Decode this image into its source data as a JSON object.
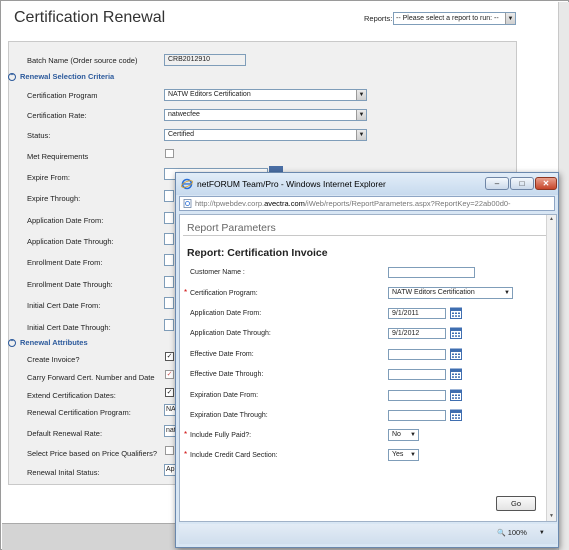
{
  "background": {
    "page_title": "Certification Renewal",
    "reports_label": "Reports:",
    "reports_select": "-- Please select a report to run: --",
    "batch_label": "Batch Name (Order source code)",
    "batch_value": "CRB2012910",
    "sections": {
      "selection": "Renewal Selection Criteria",
      "attributes": "Renewal Attributes"
    },
    "selection_fields": {
      "certification_program": {
        "label": "Certification Program",
        "value": "NATW Editors Certification"
      },
      "certification_rate": {
        "label": "Certification Rate:",
        "value": "natwecfee"
      },
      "status": {
        "label": "Status:",
        "value": "Certified"
      },
      "met_requirements": {
        "label": "Met Requirements"
      },
      "expire_from": {
        "label": "Expire From:"
      },
      "expire_through": {
        "label": "Expire Through:"
      },
      "application_date_from": {
        "label": "Application Date From:"
      },
      "application_date_through": {
        "label": "Application Date Through:"
      },
      "enrollment_date_from": {
        "label": "Enrollment Date From:"
      },
      "enrollment_date_through": {
        "label": "Enrollment Date Through:"
      },
      "initial_cert_date_from": {
        "label": "Initial Cert Date From:"
      },
      "initial_cert_date_through": {
        "label": "Initial Cert Date Through:"
      }
    },
    "attribute_fields": {
      "create_invoice": {
        "label": "Create Invoice?",
        "checked": "✓"
      },
      "carry_forward": {
        "label": "Carry Forward Cert. Number and Date",
        "checked": "✓"
      },
      "extend_dates": {
        "label": "Extend Certification Dates:",
        "checked": "✓"
      },
      "renewal_program": {
        "label": "Renewal Certification Program:",
        "value": "NA"
      },
      "default_rate": {
        "label": "Default Renewal Rate:",
        "value": "nat"
      },
      "select_price": {
        "label": "Select Price based on Price Qualifiers?"
      },
      "initial_status": {
        "label": "Renewal Inital Status:",
        "value": "Ap"
      }
    }
  },
  "popup": {
    "window_title": "netFORUM Team/Pro - Windows Internet Explorer",
    "url_prefix": "http://tpwebdev.corp.",
    "url_domain": "avectra.com",
    "url_suffix": "/iWeb/reports/ReportParameters.aspx?ReportKey=22ab00d0-",
    "heading": "Report Parameters",
    "report_title": "Report: Certification Invoice",
    "fields": {
      "customer_name": {
        "label": "Customer Name :",
        "value": ""
      },
      "certification_program": {
        "label": "Certification Program:",
        "value": "NATW Editors Certification"
      },
      "application_date_from": {
        "label": "Application Date From:",
        "value": "9/1/2011"
      },
      "application_date_through": {
        "label": "Application Date Through:",
        "value": "9/1/2012"
      },
      "effective_date_from": {
        "label": "Effective Date From:",
        "value": ""
      },
      "effective_date_through": {
        "label": "Effective Date Through:",
        "value": ""
      },
      "expiration_date_from": {
        "label": "Expiration Date From:",
        "value": ""
      },
      "expiration_date_through": {
        "label": "Expiration Date Through:",
        "value": ""
      },
      "include_fully_paid": {
        "label": "Include Fully Paid?:",
        "value": "No"
      },
      "include_credit_card": {
        "label": "Include Credit Card Section:",
        "value": "Yes"
      }
    },
    "required_marker": "*",
    "go_label": "Go",
    "zoom": "100%",
    "window_buttons": {
      "minimize": "–",
      "maximize": "□",
      "close": "✕"
    }
  }
}
